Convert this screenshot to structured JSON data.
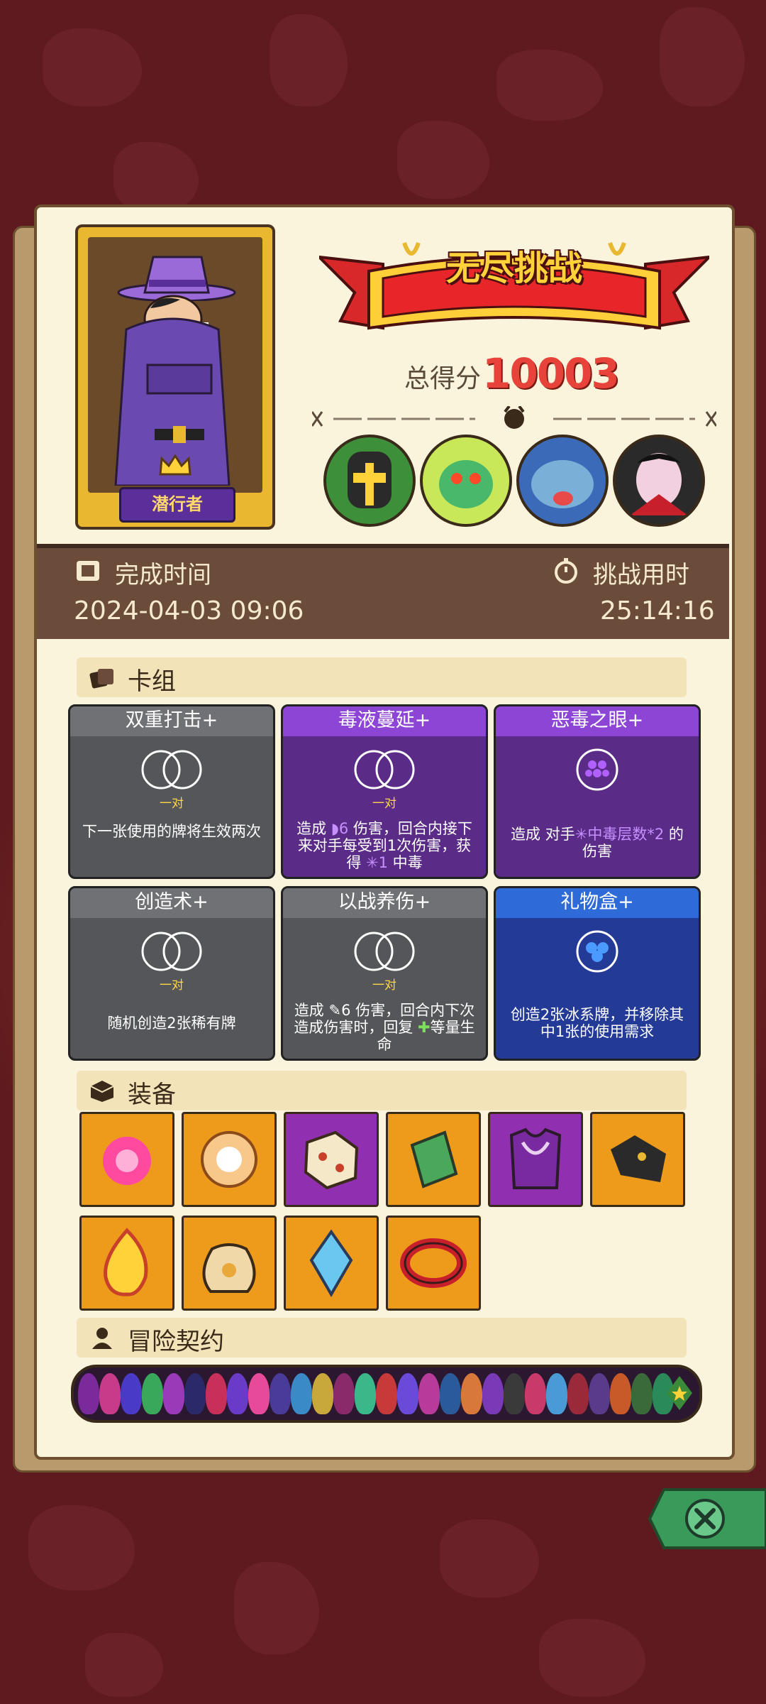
{
  "header": {
    "banner_title": "无尽挑战",
    "score_label": "总得分",
    "score_value": "10003"
  },
  "character": {
    "name": "潜行者"
  },
  "stats": {
    "finish_time_label": "完成时间",
    "finish_time_value": "2024-04-03 09:06",
    "duration_label": "挑战用时",
    "duration_value": "25:14:16"
  },
  "deck": {
    "title": "卡组",
    "cards": [
      {
        "name": "双重打击+",
        "tag": "一对",
        "desc": "下一张使用的牌将生效两次",
        "color": "gray"
      },
      {
        "name": "毒液蔓延+",
        "tag": "一对",
        "desc_a": "造成",
        "desc_num": "6",
        "desc_b": "伤害，回合内接下来对手每受到1次伤害，获得",
        "desc_num2": "1",
        "desc_c": "中毒",
        "color": "purple"
      },
      {
        "name": "恶毒之眼+",
        "desc_a": "造成 对手",
        "desc_hl": "中毒层数*2",
        "desc_b": "的伤害",
        "color": "purple"
      },
      {
        "name": "创造术+",
        "tag": "一对",
        "desc": "随机创造2张稀有牌",
        "color": "gray"
      },
      {
        "name": "以战养伤+",
        "tag": "一对",
        "desc_a": "造成",
        "desc_num": "6",
        "desc_b": "伤害，回合内下次造成伤害时，回复",
        "desc_c": "等量生命",
        "color": "gray"
      },
      {
        "name": "礼物盒+",
        "desc": "创造2张冰系牌，并移除其中1张的使用需求",
        "color": "blue"
      }
    ]
  },
  "equipment": {
    "title": "装备",
    "items": [
      "pink-fireball-icon",
      "gold-ring-icon",
      "spiked-cube-icon",
      "green-scroll-icon",
      "purple-armor-icon",
      "dark-boots-icon",
      "fire-spirit-icon",
      "coin-sack-icon",
      "crystal-potion-icon",
      "spiked-bracelet-icon"
    ]
  },
  "contract": {
    "title": "冒险契约"
  },
  "colors": {
    "accent": "#e8433a",
    "gold": "#ffd23a",
    "band": "#6b4c3a"
  }
}
